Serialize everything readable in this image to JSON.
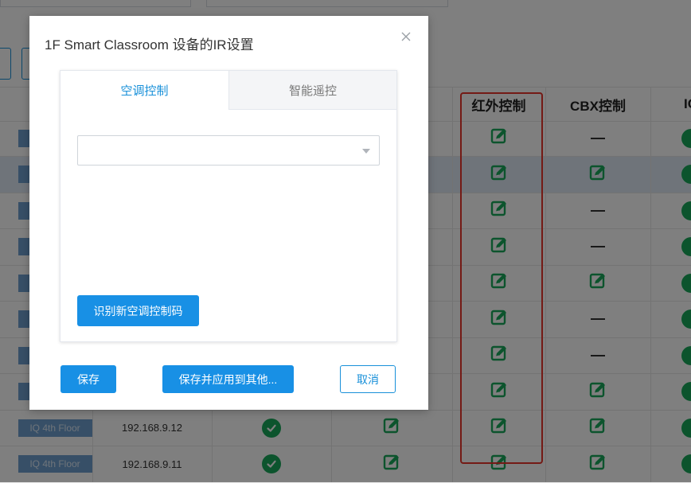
{
  "dialog": {
    "title": "1F Smart Classroom 设备的IR设置",
    "tabs": [
      {
        "label": "空调控制",
        "active": true
      },
      {
        "label": "智能遥控",
        "active": false
      }
    ],
    "select_value": "",
    "learn_button": "识别新空调控制码",
    "save_button": "保存",
    "save_apply_button": "保存并应用到其他...",
    "cancel_button": "取消"
  },
  "table": {
    "headers": {
      "ir": "红外控制",
      "cbx": "CBX控制",
      "partial": "IC"
    },
    "rows": [
      {
        "floor": "",
        "ip": "",
        "online": null,
        "ir": true,
        "cbx": false,
        "selected": false
      },
      {
        "floor": "",
        "ip": "",
        "online": null,
        "ir": true,
        "cbx": true,
        "selected": true
      },
      {
        "floor": "",
        "ip": "",
        "online": null,
        "ir": true,
        "cbx": false,
        "selected": false
      },
      {
        "floor": "",
        "ip": "",
        "online": null,
        "ir": true,
        "cbx": false,
        "selected": false
      },
      {
        "floor": "",
        "ip": "",
        "online": null,
        "ir": true,
        "cbx": true,
        "selected": false
      },
      {
        "floor": "",
        "ip": "",
        "online": null,
        "ir": true,
        "cbx": false,
        "selected": false
      },
      {
        "floor": "",
        "ip": "",
        "online": null,
        "ir": true,
        "cbx": false,
        "selected": false
      },
      {
        "floor": "",
        "ip": "",
        "online": null,
        "ir": true,
        "cbx": true,
        "selected": false
      },
      {
        "floor": "IQ 4th Floor",
        "ip": "192.168.9.12",
        "online": true,
        "ir": true,
        "cbx": true,
        "selected": false
      },
      {
        "floor": "IQ 4th Floor",
        "ip": "192.168.9.11",
        "online": true,
        "ir": true,
        "cbx": true,
        "selected": false
      }
    ]
  },
  "colors": {
    "accent": "#1890e5",
    "status_green": "#18a85a",
    "highlight_red": "#e8352a",
    "floor_tag": "#6f9fcf"
  },
  "icons": {
    "edit": "edit-icon",
    "ok": "check-circle-icon",
    "close": "close-icon",
    "dropdown": "chevron-down-icon"
  }
}
